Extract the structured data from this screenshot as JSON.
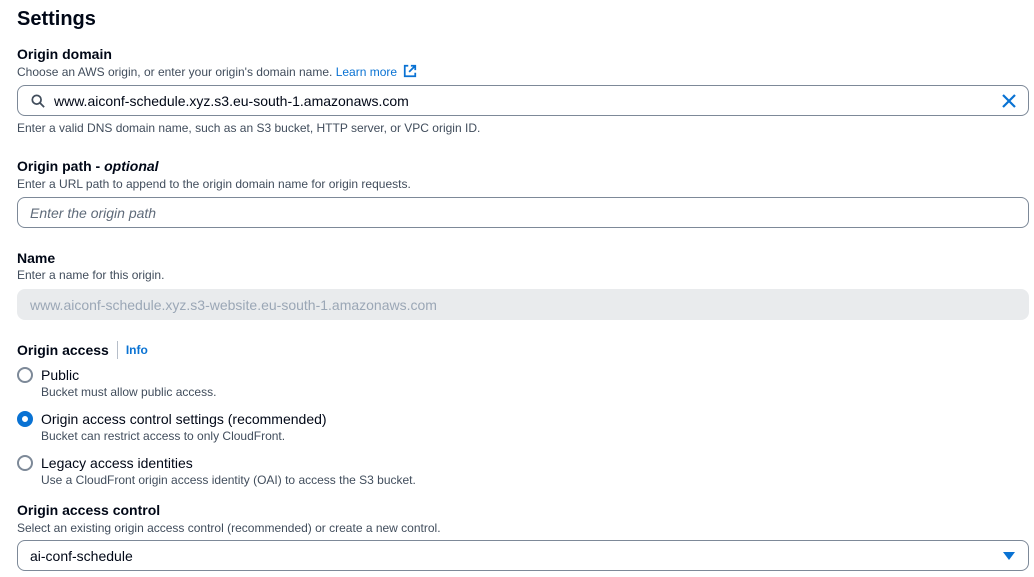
{
  "section": {
    "title": "Settings"
  },
  "origin_domain": {
    "label": "Origin domain",
    "description": "Choose an AWS origin, or enter your origin's domain name.",
    "learn_more": "Learn more",
    "value": "www.aiconf-schedule.xyz.s3.eu-south-1.amazonaws.com",
    "hint": "Enter a valid DNS domain name, such as an S3 bucket, HTTP server, or VPC origin ID."
  },
  "origin_path": {
    "label": "Origin path - ",
    "label_optional": "optional",
    "description": "Enter a URL path to append to the origin domain name for origin requests.",
    "placeholder": "Enter the origin path"
  },
  "name": {
    "label": "Name",
    "description": "Enter a name for this origin.",
    "value": "www.aiconf-schedule.xyz.s3-website.eu-south-1.amazonaws.com"
  },
  "origin_access": {
    "label": "Origin access",
    "info": "Info",
    "options": [
      {
        "label": "Public",
        "description": "Bucket must allow public access.",
        "selected": false
      },
      {
        "label": "Origin access control settings (recommended)",
        "description": "Bucket can restrict access to only CloudFront.",
        "selected": true
      },
      {
        "label": "Legacy access identities",
        "description": "Use a CloudFront origin access identity (OAI) to access the S3 bucket.",
        "selected": false
      }
    ]
  },
  "origin_access_control": {
    "label": "Origin access control",
    "description": "Select an existing origin access control (recommended) or create a new control.",
    "selected_value": "ai-conf-schedule"
  },
  "colors": {
    "accent": "#0972d3",
    "text": "#000716",
    "secondary_text": "#414d5c",
    "border": "#7d8998",
    "disabled_bg": "#e9ebed"
  }
}
